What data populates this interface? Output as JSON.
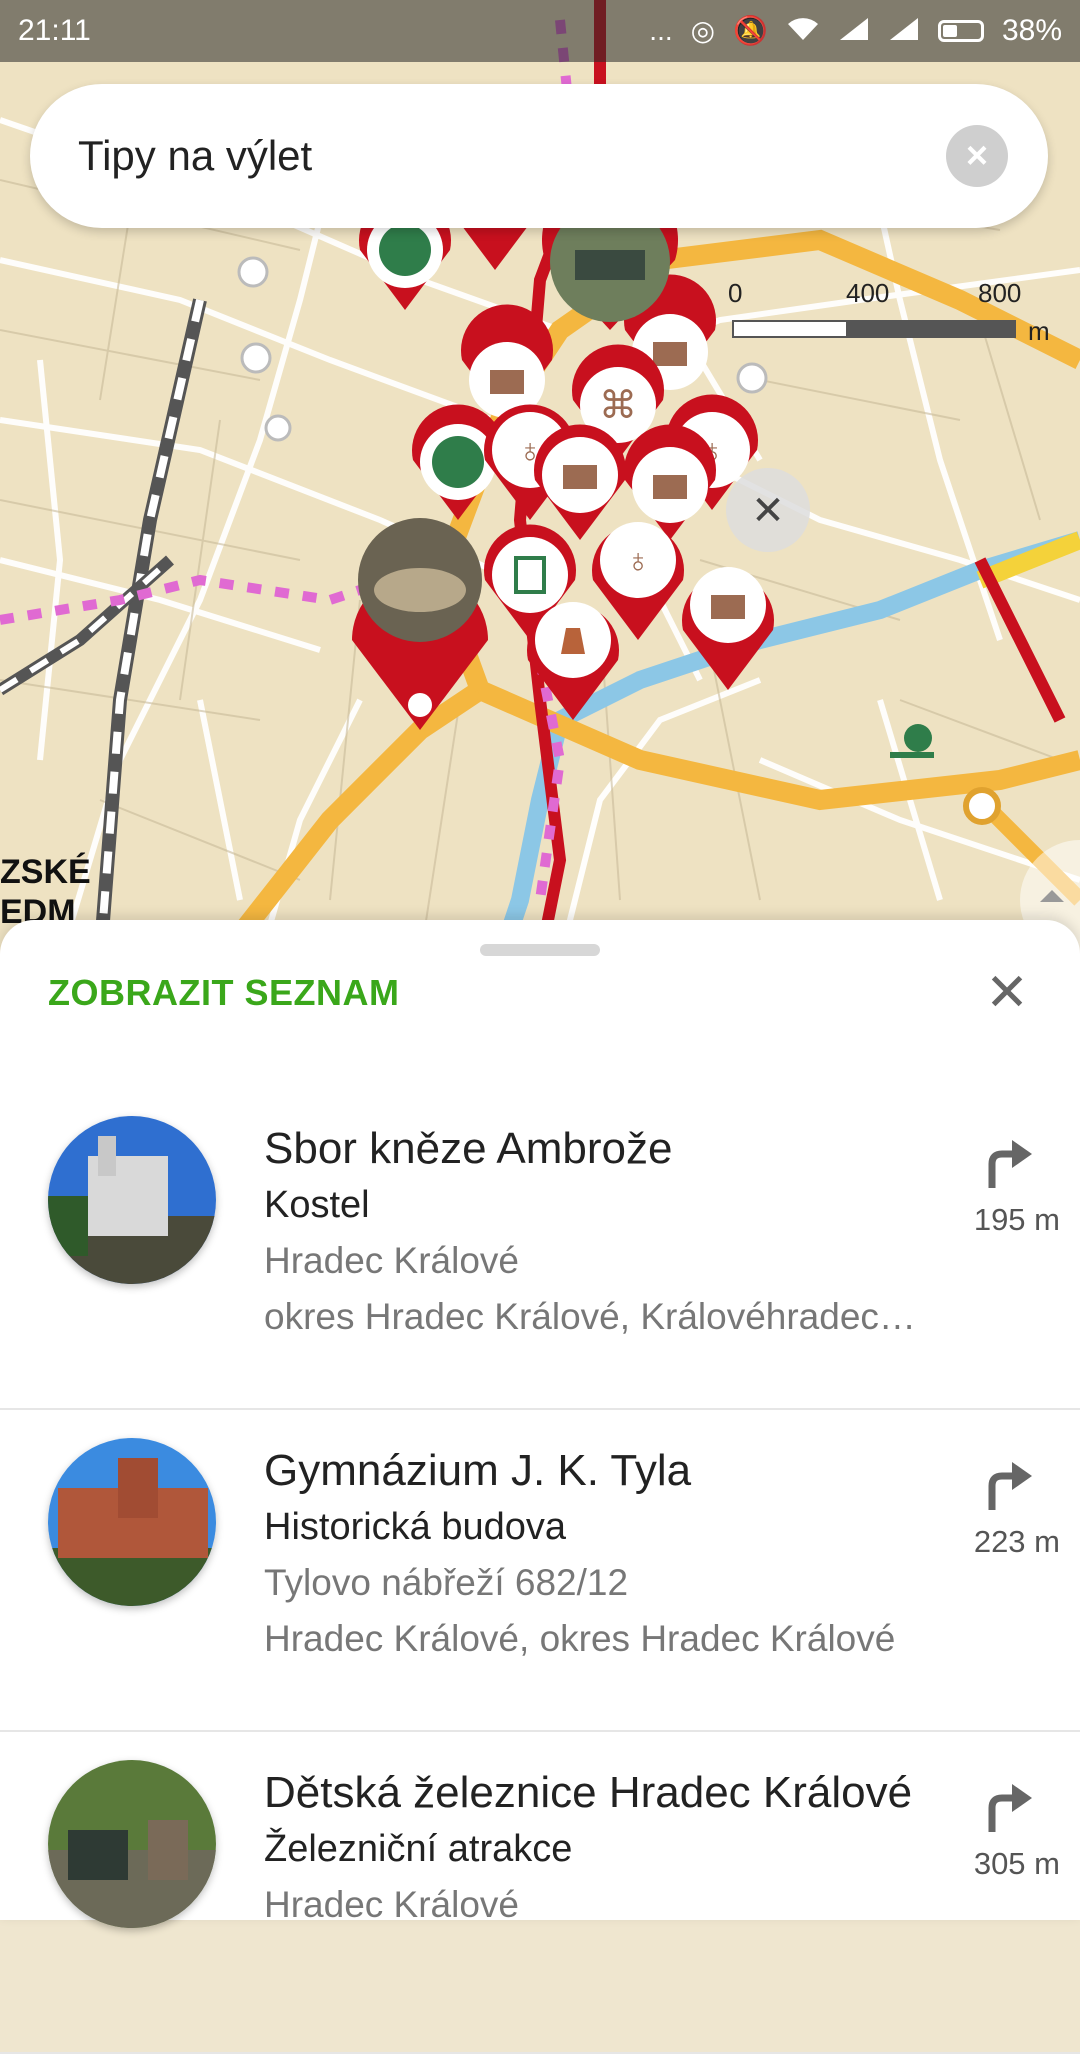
{
  "status_bar": {
    "time": "21:11",
    "dots": "...",
    "battery_percent": "38%",
    "battery_level": 0.38
  },
  "search": {
    "query": "Tipy na výlet",
    "clear_icon": "close-circle-icon"
  },
  "scale": {
    "label0": "0",
    "label1": "400",
    "label2": "800",
    "unit": "m"
  },
  "map": {
    "label_line1": "ZSKÉ",
    "label_line2": "EDM"
  },
  "sheet": {
    "title": "ZOBRAZIT SEZNAM",
    "close_icon": "close-icon"
  },
  "results": [
    {
      "name": "Sbor kněze Ambrože",
      "category": "Kostel",
      "address1": "Hradec Králové",
      "address2": "okres Hradec Králové, Královéhradecký kraj",
      "distance": "195 m"
    },
    {
      "name": "Gymnázium J. K. Tyla",
      "category": "Historická budova",
      "address1": "Tylovo nábřeží 682/12",
      "address2": "Hradec Králové, okres Hradec Králové",
      "distance": "223 m"
    },
    {
      "name": "Dětská železnice Hradec Králové",
      "category": "Železniční atrakce",
      "address1": "Hradec Králové",
      "address2": "",
      "distance": "305 m"
    }
  ],
  "colors": {
    "accent_green": "#3aa71a",
    "pin_red": "#c8101e",
    "road_orange": "#f4b740",
    "water_blue": "#8cc7e6"
  }
}
